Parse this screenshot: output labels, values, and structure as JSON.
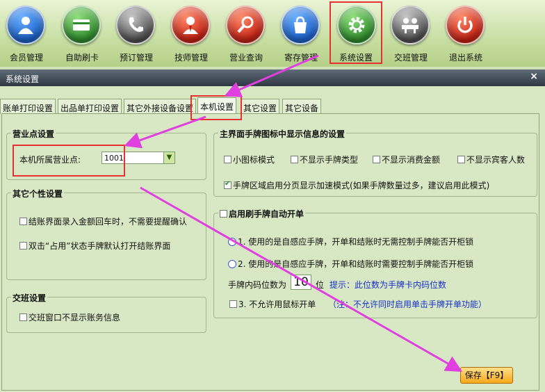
{
  "toolbar": {
    "items": [
      {
        "label": "会员管理",
        "icon": "member-icon"
      },
      {
        "label": "自助刷卡",
        "icon": "card-icon"
      },
      {
        "label": "预订管理",
        "icon": "phone-icon"
      },
      {
        "label": "技师管理",
        "icon": "technician-icon"
      },
      {
        "label": "营业查询",
        "icon": "search-icon"
      },
      {
        "label": "寄存管理",
        "icon": "bag-icon"
      },
      {
        "label": "系统设置",
        "icon": "gear-icon"
      },
      {
        "label": "交班管理",
        "icon": "handover-icon"
      },
      {
        "label": "退出系统",
        "icon": "power-icon"
      }
    ]
  },
  "window": {
    "title": "系统设置",
    "close": "×"
  },
  "tabs": [
    "账单打印设置",
    "出品单打印设置",
    "其它外接设备设置",
    "本机设置",
    "其它设置",
    "其它设备"
  ],
  "business_point": {
    "title": "营业点设置",
    "label": "本机所属营业点:",
    "value": "1001"
  },
  "personal": {
    "title": "其它个性设置",
    "opt1": "结账界面录入金额回车时，不需要提醒确认",
    "opt2": "双击“占用”状态手牌默认打开结账界面"
  },
  "shift": {
    "title": "交班设置",
    "opt1": "交班窗口不显示账务信息"
  },
  "display": {
    "title": "主界面手牌图标中显示信息的设置",
    "opt_small": "小图标模式",
    "opt_type": "不显示手牌类型",
    "opt_amount": "不显示消费金额",
    "opt_guests": "不显示宾客人数",
    "opt_paging": "手牌区域启用分页显示加速模式(如果手牌数量过多，建议启用此模式)"
  },
  "auto_open": {
    "title": "启用刷手牌自动开单",
    "radio1": "1. 使用的是自感应手牌，开单和结账时无需控制手牌能否开柜锁",
    "radio2": "2. 使用的是自感应手牌，开单和结账时需要控制手牌能否开柜锁",
    "code_label": "手牌内码位数为",
    "code_value": "10",
    "code_unit": "位",
    "hint": "提示：此位数为手牌卡内码位数",
    "opt_mouse": "3. 不允许用鼠标开单",
    "note": "（注：不允许同时启用单击手牌开单功能）"
  },
  "save_label": "保存【F9】"
}
